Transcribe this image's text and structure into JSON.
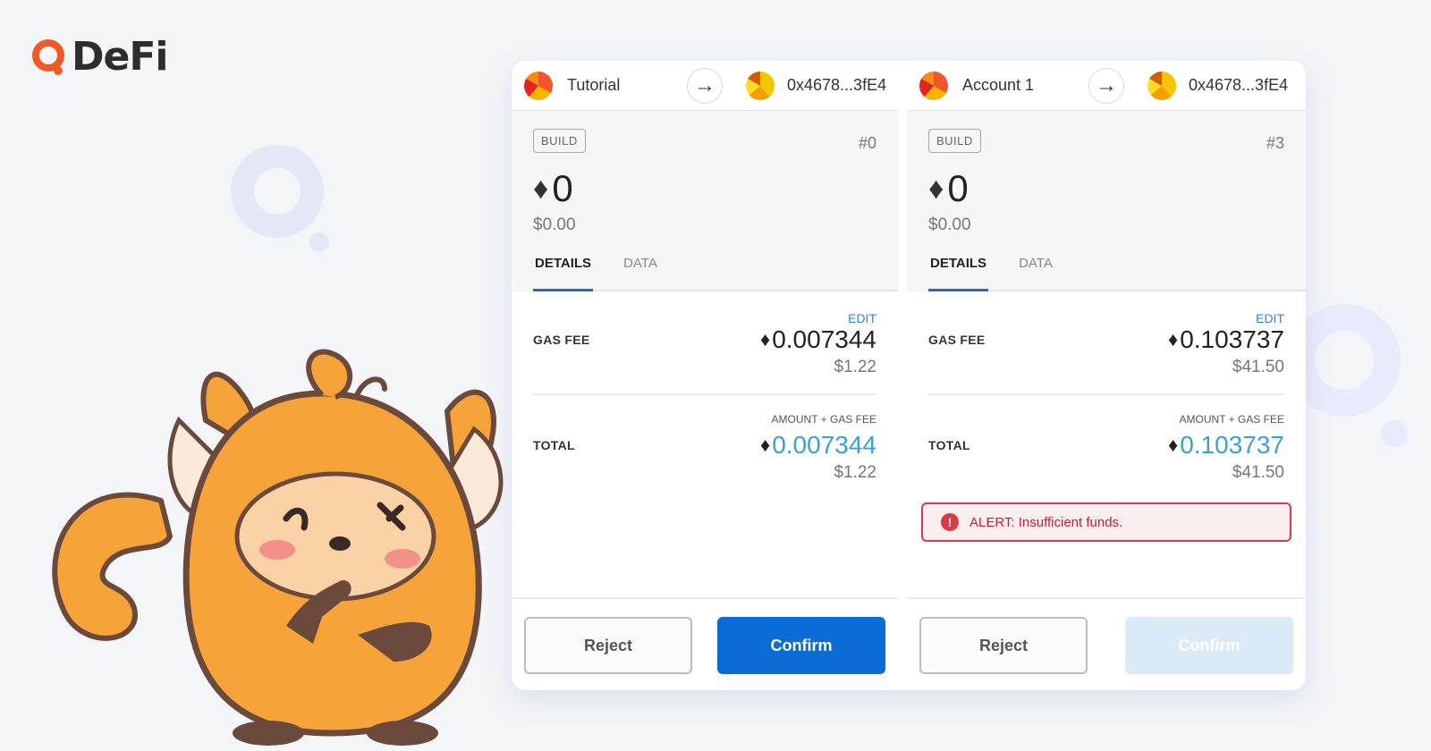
{
  "brand": {
    "name": "DeFi",
    "accent": "#f05a28"
  },
  "left": {
    "from_name": "Tutorial",
    "to_address": "0x4678...3fE4",
    "tag": "BUILD",
    "nonce": "#0",
    "amount": "0",
    "amount_fiat": "$0.00",
    "tabs": [
      "DETAILS",
      "DATA"
    ],
    "edit": "EDIT",
    "gas_label": "GAS FEE",
    "gas_eth": "0.007344",
    "gas_usd": "$1.22",
    "total_sublabel": "AMOUNT + GAS FEE",
    "total_label": "TOTAL",
    "total_eth": "0.007344",
    "total_usd": "$1.22",
    "reject": "Reject",
    "confirm": "Confirm"
  },
  "right": {
    "from_name": "Account 1",
    "to_address": "0x4678...3fE4",
    "tag": "BUILD",
    "nonce": "#3",
    "amount": "0",
    "amount_fiat": "$0.00",
    "tabs": [
      "DETAILS",
      "DATA"
    ],
    "edit": "EDIT",
    "gas_label": "GAS FEE",
    "gas_eth": "0.103737",
    "gas_usd": "$41.50",
    "total_sublabel": "AMOUNT + GAS FEE",
    "total_label": "TOTAL",
    "total_eth": "0.103737",
    "total_usd": "$41.50",
    "alert": "ALERT: Insufficient funds.",
    "reject": "Reject",
    "confirm": "Confirm"
  },
  "icons": {
    "eth": "ethereum-icon",
    "arrow": "arrow-right-icon",
    "alert": "alert-circle-icon"
  }
}
